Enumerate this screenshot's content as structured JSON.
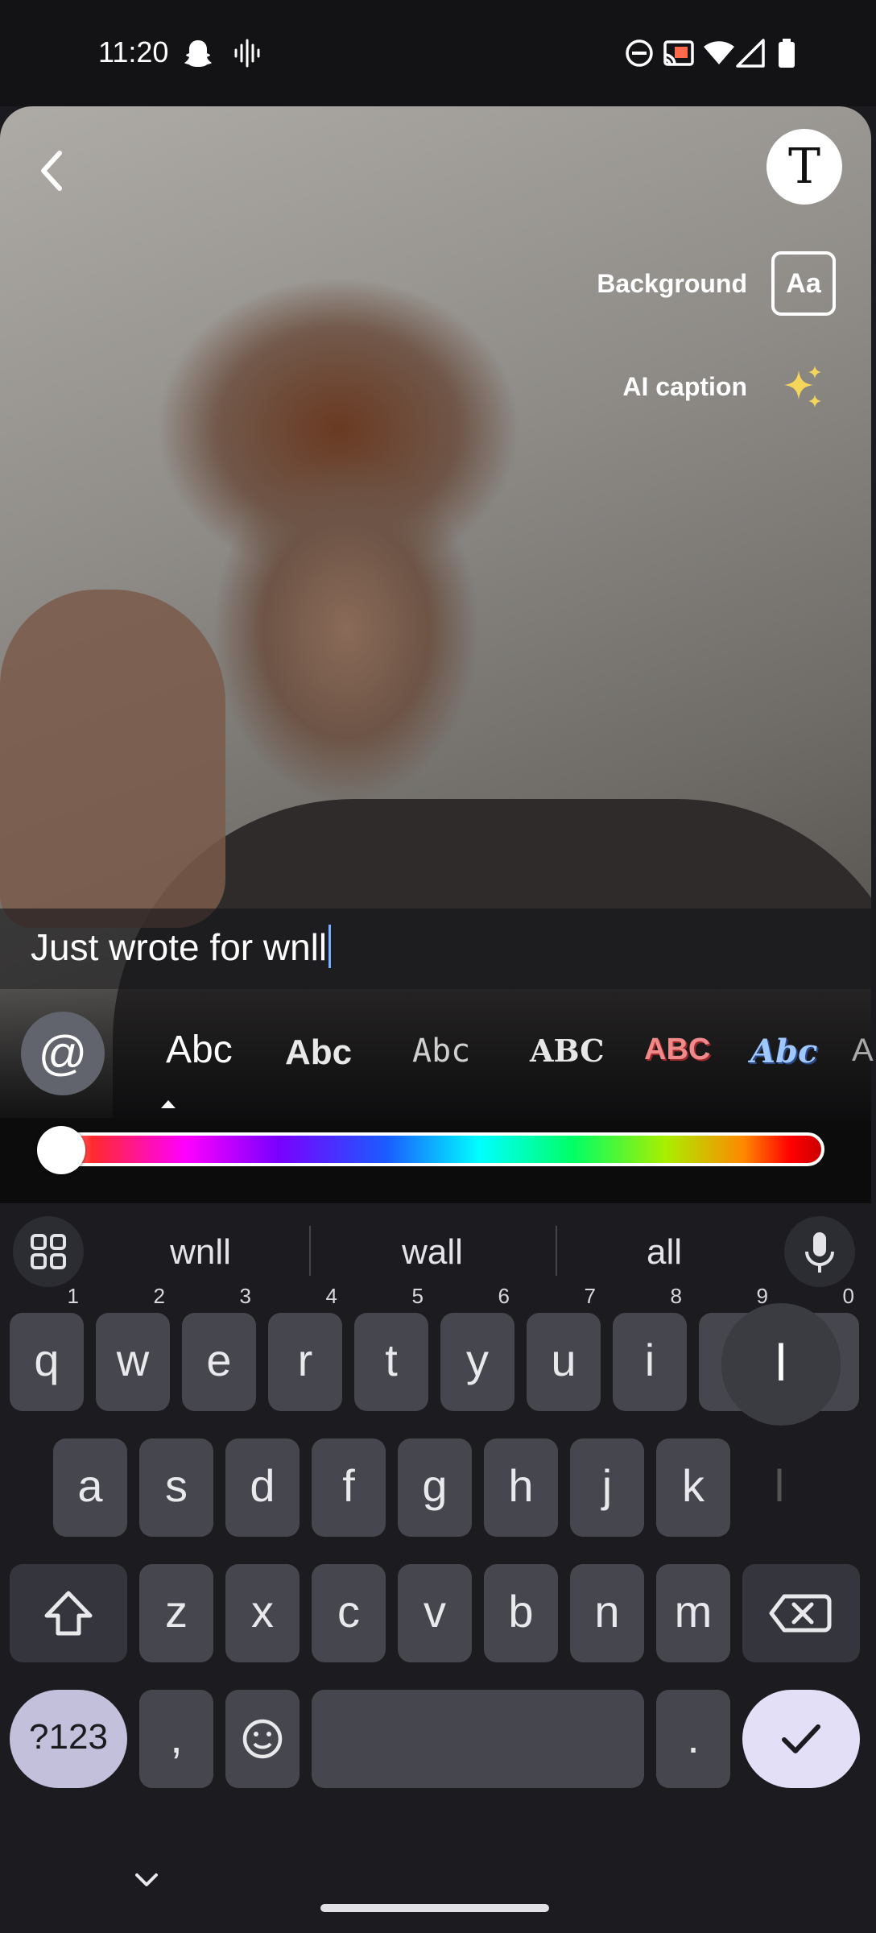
{
  "status_bar": {
    "time": "11:20",
    "icons": [
      "snapchat-ghost-icon",
      "voice-wave-icon",
      "do-not-disturb-icon",
      "cast-icon",
      "wifi-icon",
      "cell-signal-icon",
      "battery-icon"
    ]
  },
  "editor": {
    "background_label": "Background",
    "background_button": "Aa",
    "ai_caption_label": "AI caption",
    "text_tool_label": "T",
    "caption_text": "Just wrote for wnll",
    "mention_symbol": "@",
    "font_options": [
      "Abc",
      "Abc",
      "Abc",
      "ABC",
      "ABC",
      "Abc",
      "A"
    ],
    "selected_font_index": 0,
    "color_slider_value": 0
  },
  "keyboard": {
    "suggestions": [
      "wnll",
      "wall",
      "all"
    ],
    "row1": [
      "q",
      "w",
      "e",
      "r",
      "t",
      "y",
      "u",
      "i",
      "o",
      "p"
    ],
    "row1_hints": [
      "1",
      "2",
      "3",
      "4",
      "5",
      "6",
      "7",
      "8",
      "9",
      "0"
    ],
    "row2": [
      "a",
      "s",
      "d",
      "f",
      "g",
      "h",
      "j",
      "k",
      "l"
    ],
    "row3": [
      "z",
      "x",
      "c",
      "v",
      "b",
      "n",
      "m"
    ],
    "symbols_label": "?123",
    "comma": ",",
    "period": ".",
    "popup_char": "l"
  },
  "colors": {
    "keyboard_bg": "#1c1b20",
    "key_bg": "#46464e",
    "enter_key": "#e2dff7",
    "symbols_key": "#c3c0dc"
  }
}
